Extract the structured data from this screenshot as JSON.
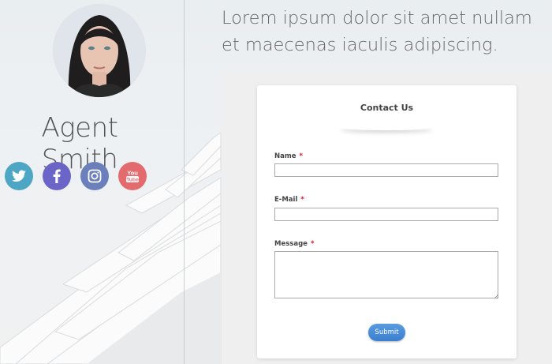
{
  "profile": {
    "name": "Agent Smith",
    "socials": [
      {
        "icon": "twitter-icon",
        "color": "#4ea6c5"
      },
      {
        "icon": "facebook-icon",
        "color": "#6a65c6"
      },
      {
        "icon": "instagram-icon",
        "color": "#6b7fba"
      },
      {
        "icon": "youtube-icon",
        "color": "#e36b6e",
        "label": "You Tube"
      }
    ]
  },
  "tagline": "Lorem ipsum dolor sit amet nullam et maecenas iaculis adipiscing.",
  "form": {
    "title": "Contact Us",
    "fields": [
      {
        "label": "Name",
        "required": "*",
        "value": ""
      },
      {
        "label": "E-Mail",
        "required": "*",
        "value": ""
      },
      {
        "label": "Message",
        "required": "*",
        "value": ""
      }
    ],
    "submit_label": "Submit"
  }
}
